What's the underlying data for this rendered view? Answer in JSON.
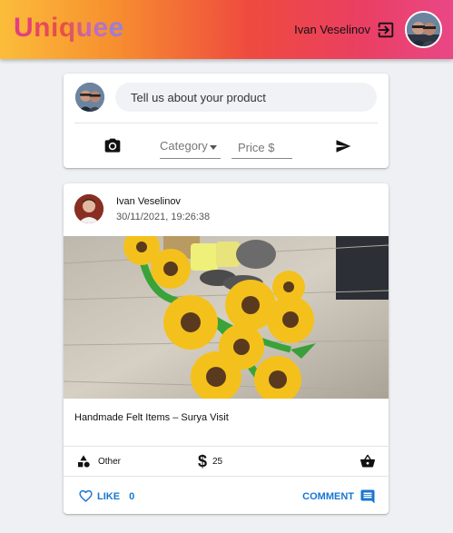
{
  "header": {
    "logo": "Uniquee",
    "user_name": "Ivan Veselinov",
    "logout_icon": "logout-icon",
    "avatar_icon": "user-avatar-photo"
  },
  "composer": {
    "placeholder": "Tell us about your product",
    "category_label": "Category",
    "price_placeholder": "Price $",
    "camera_icon": "camera-icon",
    "send_icon": "send-icon"
  },
  "post": {
    "author": "Ivan Veselinov",
    "timestamp": "30/11/2021, 19:26:38",
    "title": "Handmade Felt Items – Surya Visit",
    "category": "Other",
    "price": "25",
    "likes_label": "LIKE",
    "likes_count": "0",
    "comment_label": "COMMENT"
  },
  "colors": {
    "accent": "#1976d2",
    "header_gradient": [
      "#fbbd3a",
      "#ef4a3f",
      "#e94786"
    ]
  }
}
